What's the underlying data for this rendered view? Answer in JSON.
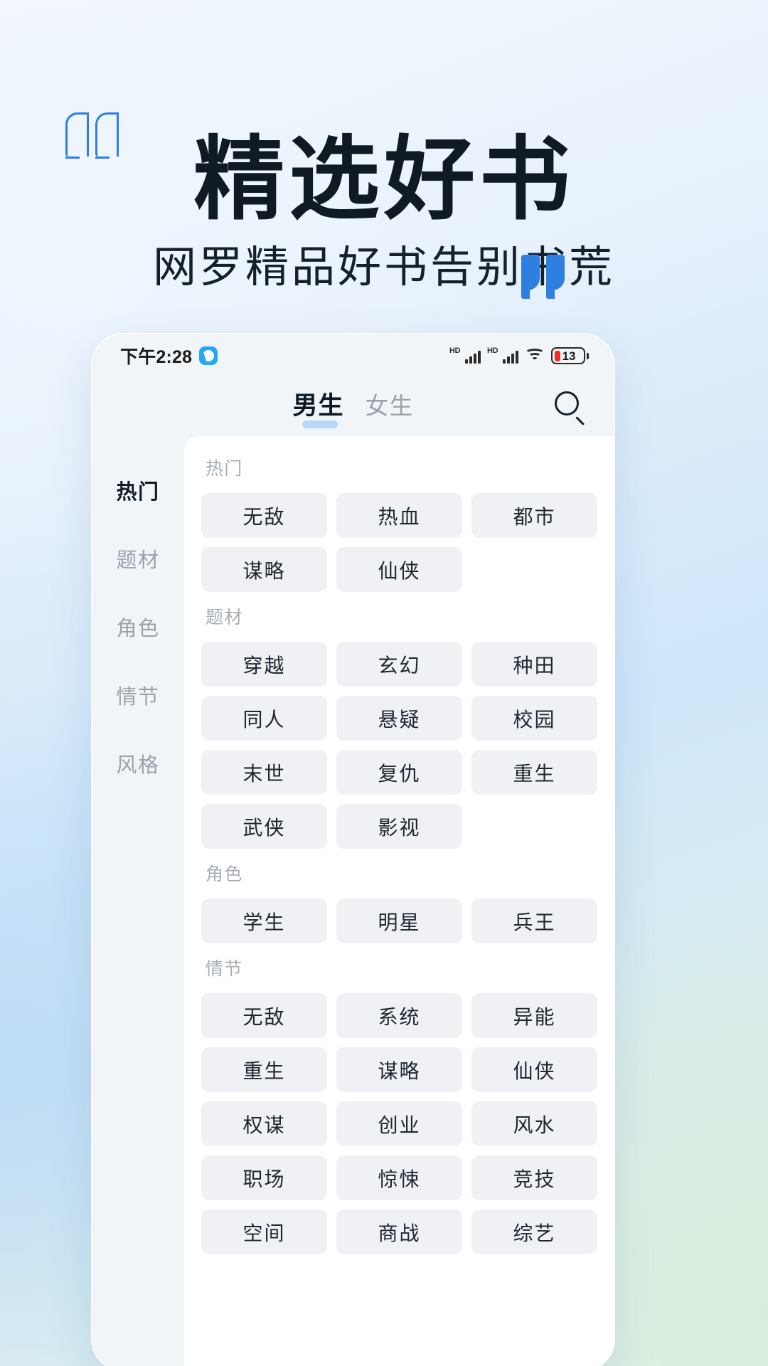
{
  "promo": {
    "headline": "精选好书",
    "subtitle": "网罗精品好书告别书荒",
    "quote_open_name": "quote-open-mark",
    "quote_close_name": "quote-close-mark",
    "accent_blue": "#2f7fe0",
    "headline_color": "#101a24"
  },
  "phone": {
    "statusbar": {
      "time": "下午2:28",
      "app_badge_icon": "app-badge-icon",
      "signal_1_label": "HD",
      "signal_2_label": "HD",
      "wifi_icon": "wifi-icon",
      "battery_percent": "13",
      "battery_low_color": "#ef2b2b"
    },
    "navbar": {
      "tabs": [
        {
          "label": "男生",
          "active": true
        },
        {
          "label": "女生",
          "active": false
        }
      ],
      "search_icon": "search-icon",
      "active_underline_color": "#b7d9f5"
    },
    "sidebar": {
      "items": [
        {
          "label": "热门",
          "active": true
        },
        {
          "label": "题材",
          "active": false
        },
        {
          "label": "角色",
          "active": false
        },
        {
          "label": "情节",
          "active": false
        },
        {
          "label": "风格",
          "active": false
        }
      ]
    },
    "groups": [
      {
        "title": "热门",
        "tags": [
          "无敌",
          "热血",
          "都市",
          "谋略",
          "仙侠"
        ]
      },
      {
        "title": "题材",
        "tags": [
          "穿越",
          "玄幻",
          "种田",
          "同人",
          "悬疑",
          "校园",
          "末世",
          "复仇",
          "重生",
          "武侠",
          "影视"
        ]
      },
      {
        "title": "角色",
        "tags": [
          "学生",
          "明星",
          "兵王"
        ]
      },
      {
        "title": "情节",
        "tags": [
          "无敌",
          "系统",
          "异能",
          "重生",
          "谋略",
          "仙侠",
          "权谋",
          "创业",
          "风水",
          "职场",
          "惊悚",
          "竞技",
          "空间",
          "商战",
          "综艺"
        ]
      }
    ]
  }
}
